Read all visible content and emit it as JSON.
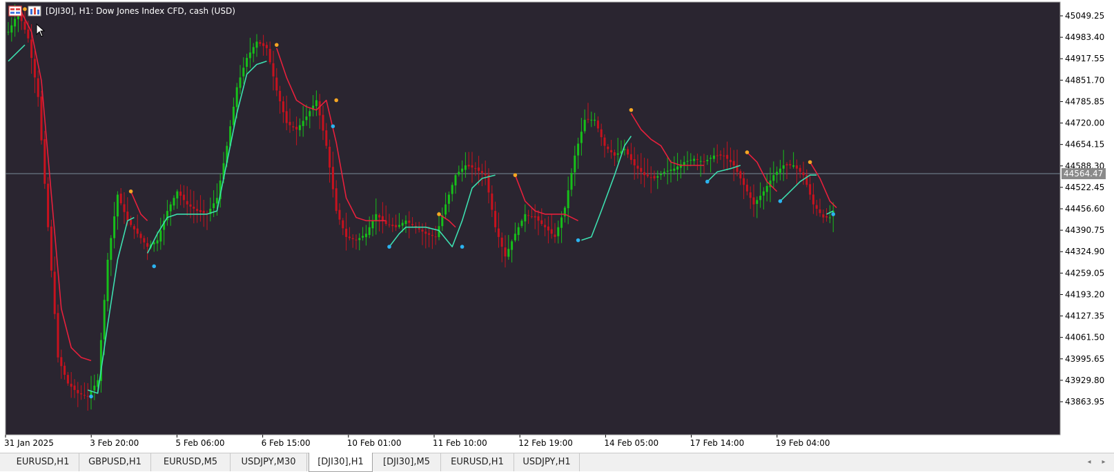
{
  "window": {
    "title": "[DJI30], H1:  Dow Jones Index CFD, cash (USD)",
    "icons": [
      "symbol-grid-icon",
      "chart-type-icon"
    ]
  },
  "colors": {
    "background": "#2a2530",
    "frame": "#ffffff",
    "bull": "#17c01a",
    "bear": "#c8121e",
    "trail_up": "#3de0b0",
    "trail_down": "#e8203c",
    "dot_high": "#f5a623",
    "dot_low": "#2bb3f0",
    "bid_line": "#7a8a99"
  },
  "chart_data": {
    "type": "candlestick",
    "symbol": "[DJI30]",
    "timeframe": "H1",
    "ylim": [
      43820,
      45080
    ],
    "y_ticks": [
      "45049.25",
      "44983.40",
      "44917.55",
      "44851.70",
      "44785.85",
      "44720.00",
      "44654.15",
      "44588.30",
      "44522.45",
      "44456.60",
      "44390.75",
      "44324.90",
      "44259.05",
      "44193.20",
      "44127.35",
      "44061.50",
      "43995.65",
      "43929.80",
      "43863.95"
    ],
    "current_price": "44564.47",
    "x_ticks": [
      "31 Jan 2025",
      "3 Feb 20:00",
      "5 Feb 06:00",
      "6 Feb 15:00",
      "10 Feb 01:00",
      "11 Feb 10:00",
      "12 Feb 19:00",
      "14 Feb 05:00",
      "17 Feb 14:00",
      "19 Feb 04:00"
    ],
    "close_path": [
      [
        0,
        45000
      ],
      [
        3,
        45060
      ],
      [
        6,
        44980
      ],
      [
        9,
        44800
      ],
      [
        12,
        44400
      ],
      [
        15,
        44000
      ],
      [
        18,
        43920
      ],
      [
        21,
        43890
      ],
      [
        24,
        43880
      ],
      [
        27,
        43930
      ],
      [
        30,
        44300
      ],
      [
        33,
        44500
      ],
      [
        36,
        44420
      ],
      [
        39,
        44380
      ],
      [
        42,
        44340
      ],
      [
        45,
        44360
      ],
      [
        48,
        44450
      ],
      [
        51,
        44510
      ],
      [
        54,
        44470
      ],
      [
        57,
        44450
      ],
      [
        60,
        44440
      ],
      [
        63,
        44490
      ],
      [
        66,
        44650
      ],
      [
        69,
        44830
      ],
      [
        72,
        44920
      ],
      [
        75,
        44970
      ],
      [
        78,
        44950
      ],
      [
        81,
        44820
      ],
      [
        84,
        44720
      ],
      [
        87,
        44700
      ],
      [
        90,
        44740
      ],
      [
        93,
        44790
      ],
      [
        96,
        44650
      ],
      [
        99,
        44450
      ],
      [
        102,
        44370
      ],
      [
        105,
        44360
      ],
      [
        108,
        44380
      ],
      [
        111,
        44440
      ],
      [
        114,
        44410
      ],
      [
        117,
        44400
      ],
      [
        120,
        44420
      ],
      [
        123,
        44400
      ],
      [
        126,
        44380
      ],
      [
        129,
        44370
      ],
      [
        132,
        44470
      ],
      [
        135,
        44560
      ],
      [
        138,
        44590
      ],
      [
        141,
        44580
      ],
      [
        144,
        44560
      ],
      [
        147,
        44400
      ],
      [
        150,
        44310
      ],
      [
        153,
        44380
      ],
      [
        156,
        44440
      ],
      [
        159,
        44430
      ],
      [
        162,
        44400
      ],
      [
        165,
        44370
      ],
      [
        168,
        44460
      ],
      [
        171,
        44620
      ],
      [
        174,
        44730
      ],
      [
        177,
        44730
      ],
      [
        180,
        44650
      ],
      [
        183,
        44620
      ],
      [
        186,
        44640
      ],
      [
        189,
        44590
      ],
      [
        192,
        44560
      ],
      [
        195,
        44550
      ],
      [
        198,
        44570
      ],
      [
        201,
        44580
      ],
      [
        204,
        44600
      ],
      [
        207,
        44610
      ],
      [
        210,
        44600
      ],
      [
        213,
        44620
      ],
      [
        216,
        44620
      ],
      [
        219,
        44590
      ],
      [
        222,
        44530
      ],
      [
        225,
        44470
      ],
      [
        228,
        44510
      ],
      [
        231,
        44560
      ],
      [
        234,
        44590
      ],
      [
        237,
        44590
      ],
      [
        240,
        44560
      ],
      [
        243,
        44470
      ],
      [
        246,
        44430
      ],
      [
        248,
        44430
      ],
      [
        250,
        44470
      ]
    ],
    "bar_count": 250,
    "trail_up_segments": [
      [
        [
          0,
          44910
        ],
        [
          5,
          44960
        ]
      ],
      [
        [
          24,
          43900
        ],
        [
          27,
          43890
        ],
        [
          30,
          44100
        ],
        [
          33,
          44300
        ],
        [
          36,
          44420
        ],
        [
          38,
          44430
        ]
      ],
      [
        [
          42,
          44320
        ],
        [
          45,
          44380
        ],
        [
          48,
          44430
        ],
        [
          51,
          44440
        ],
        [
          60,
          44440
        ],
        [
          63,
          44450
        ],
        [
          66,
          44600
        ],
        [
          69,
          44750
        ],
        [
          72,
          44870
        ],
        [
          75,
          44900
        ],
        [
          78,
          44910
        ]
      ],
      [
        [
          97,
          44710
        ]
      ],
      [
        [
          115,
          44340
        ],
        [
          118,
          44380
        ],
        [
          120,
          44400
        ],
        [
          126,
          44400
        ],
        [
          130,
          44390
        ],
        [
          134,
          44340
        ],
        [
          137,
          44420
        ],
        [
          140,
          44520
        ],
        [
          143,
          44550
        ],
        [
          147,
          44560
        ]
      ],
      [
        [
          173,
          44360
        ],
        [
          176,
          44370
        ],
        [
          179,
          44450
        ],
        [
          183,
          44560
        ],
        [
          186,
          44650
        ],
        [
          188,
          44680
        ]
      ],
      [
        [
          211,
          44540
        ],
        [
          214,
          44570
        ],
        [
          218,
          44580
        ],
        [
          221,
          44590
        ]
      ],
      [
        [
          233,
          44480
        ],
        [
          236,
          44510
        ],
        [
          239,
          44540
        ],
        [
          242,
          44560
        ],
        [
          244,
          44560
        ]
      ],
      [
        [
          247,
          44440
        ],
        [
          249,
          44450
        ]
      ]
    ],
    "trail_down_segments": [
      [
        [
          4,
          45060
        ],
        [
          7,
          45000
        ],
        [
          10,
          44850
        ],
        [
          13,
          44500
        ],
        [
          16,
          44150
        ],
        [
          19,
          44030
        ],
        [
          22,
          44000
        ],
        [
          25,
          43990
        ]
      ],
      [
        [
          37,
          44510
        ],
        [
          40,
          44440
        ],
        [
          42,
          44420
        ]
      ],
      [
        [
          81,
          44950
        ],
        [
          84,
          44860
        ],
        [
          87,
          44790
        ],
        [
          90,
          44770
        ],
        [
          93,
          44760
        ],
        [
          96,
          44790
        ],
        [
          99,
          44660
        ],
        [
          102,
          44490
        ],
        [
          105,
          44430
        ],
        [
          108,
          44420
        ],
        [
          114,
          44420
        ]
      ],
      [
        [
          130,
          44440
        ],
        [
          133,
          44420
        ],
        [
          135,
          44400
        ]
      ],
      [
        [
          153,
          44560
        ],
        [
          156,
          44480
        ],
        [
          159,
          44450
        ],
        [
          162,
          44440
        ],
        [
          168,
          44440
        ],
        [
          172,
          44420
        ]
      ],
      [
        [
          188,
          44750
        ],
        [
          191,
          44700
        ],
        [
          194,
          44670
        ],
        [
          197,
          44650
        ],
        [
          200,
          44600
        ],
        [
          203,
          44590
        ],
        [
          210,
          44590
        ]
      ],
      [
        [
          223,
          44630
        ],
        [
          226,
          44600
        ],
        [
          229,
          44540
        ],
        [
          232,
          44510
        ]
      ],
      [
        [
          242,
          44600
        ],
        [
          245,
          44550
        ],
        [
          248,
          44480
        ],
        [
          250,
          44460
        ]
      ]
    ],
    "swing_highs": [
      [
        5,
        45070
      ],
      [
        37,
        44510
      ],
      [
        81,
        44960
      ],
      [
        99,
        44790
      ],
      [
        130,
        44440
      ],
      [
        153,
        44560
      ],
      [
        188,
        44760
      ],
      [
        223,
        44630
      ],
      [
        242,
        44600
      ]
    ],
    "swing_lows": [
      [
        25,
        43880
      ],
      [
        44,
        44280
      ],
      [
        98,
        44710
      ],
      [
        115,
        44340
      ],
      [
        137,
        44340
      ],
      [
        172,
        44360
      ],
      [
        211,
        44540
      ],
      [
        233,
        44480
      ],
      [
        249,
        44440
      ]
    ]
  },
  "tabs": [
    {
      "label": "EURUSD,H1",
      "active": false
    },
    {
      "label": "GBPUSD,H1",
      "active": false
    },
    {
      "label": "EURUSD,M5",
      "active": false
    },
    {
      "label": "USDJPY,M30",
      "active": false
    },
    {
      "label": "[DJI30],H1",
      "active": true
    },
    {
      "label": "[DJI30],M5",
      "active": false
    },
    {
      "label": "EURUSD,H1",
      "active": false
    },
    {
      "label": "USDJPY,H1",
      "active": false
    }
  ]
}
